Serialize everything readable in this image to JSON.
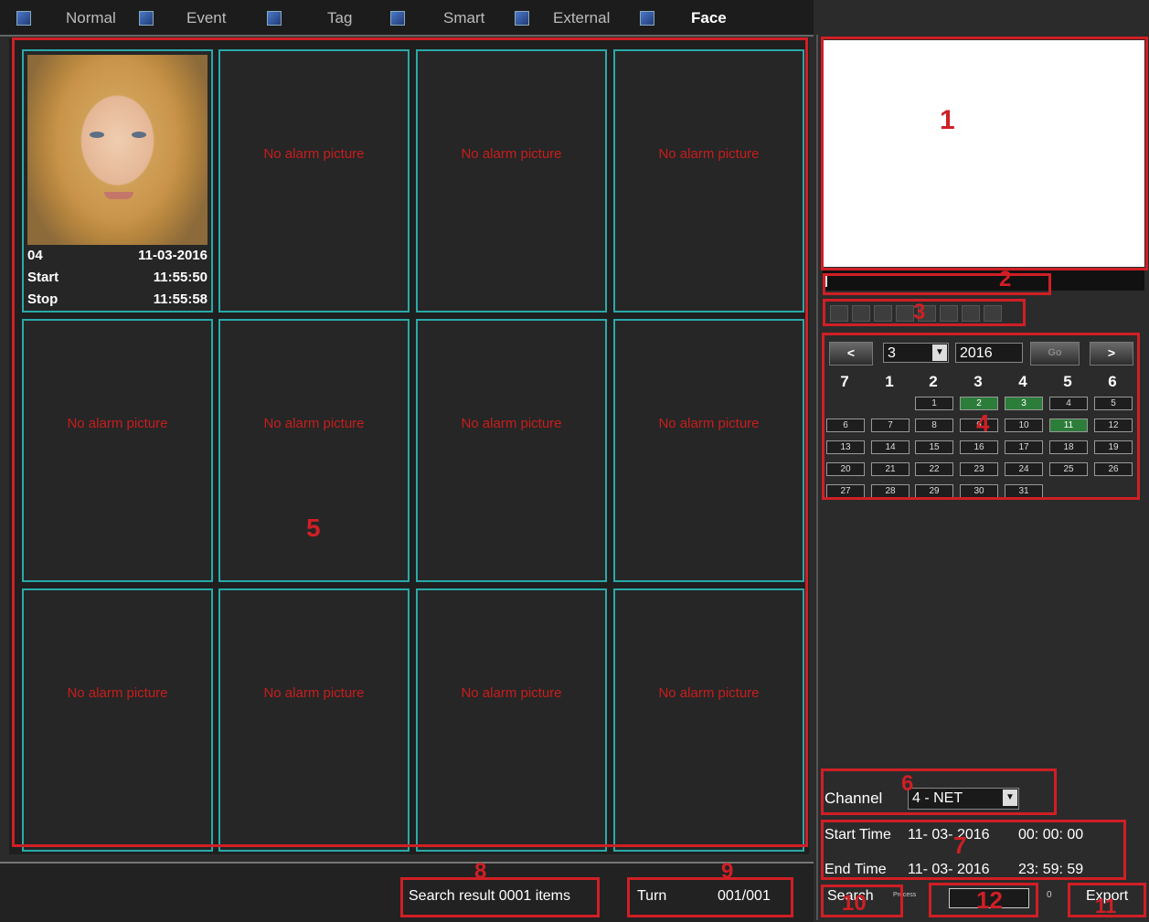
{
  "tabs": [
    {
      "label": "Normal",
      "icon": "camera-icon"
    },
    {
      "label": "Event",
      "icon": "event-icon"
    },
    {
      "label": "Tag",
      "icon": "tag-icon"
    },
    {
      "label": "Smart",
      "icon": "smart-icon"
    },
    {
      "label": "External",
      "icon": "external-icon"
    },
    {
      "label": "Face",
      "icon": "face-icon",
      "active": true
    }
  ],
  "grid": {
    "first": {
      "channel": "04",
      "date": "11-03-2016",
      "start_label": "Start",
      "start_time": "11:55:50",
      "stop_label": "Stop",
      "stop_time": "11:55:58"
    },
    "empty_text": "No alarm picture"
  },
  "calendar": {
    "prev": "<",
    "next": ">",
    "month": "3",
    "year": "2016",
    "go": "Go",
    "weekdays": [
      "7",
      "1",
      "2",
      "3",
      "4",
      "5",
      "6"
    ],
    "days": [
      "1",
      "2",
      "3",
      "4",
      "5",
      "6",
      "7",
      "8",
      "9",
      "10",
      "11",
      "12",
      "13",
      "14",
      "15",
      "16",
      "17",
      "18",
      "19",
      "20",
      "21",
      "22",
      "23",
      "24",
      "25",
      "26",
      "27",
      "28",
      "29",
      "30",
      "31"
    ],
    "recorded_days": [
      "2",
      "3",
      "11"
    ]
  },
  "channel": {
    "label": "Channel",
    "value": "4 - NET"
  },
  "time": {
    "start_label": "Start Time",
    "start_date": "11- 03- 2016",
    "start_time": "00: 00: 00",
    "end_label": "End Time",
    "end_date": "11- 03- 2016",
    "end_time": "23: 59: 59"
  },
  "bottom": {
    "result_label": "Search result",
    "result_count": "0001",
    "result_unit": "items",
    "turn_label": "Turn",
    "page": "001/001",
    "search": "Search",
    "process_label": "Process",
    "process_value": "0",
    "export": "Export"
  },
  "annotations": [
    "1",
    "2",
    "3",
    "4",
    "5",
    "6",
    "7",
    "8",
    "9",
    "10",
    "11",
    "12"
  ],
  "colors": {
    "accent": "#2aa9a9",
    "annotation": "#d01f25",
    "no_alarm": "#c81d1d",
    "recorded": "#2d7d3a"
  }
}
